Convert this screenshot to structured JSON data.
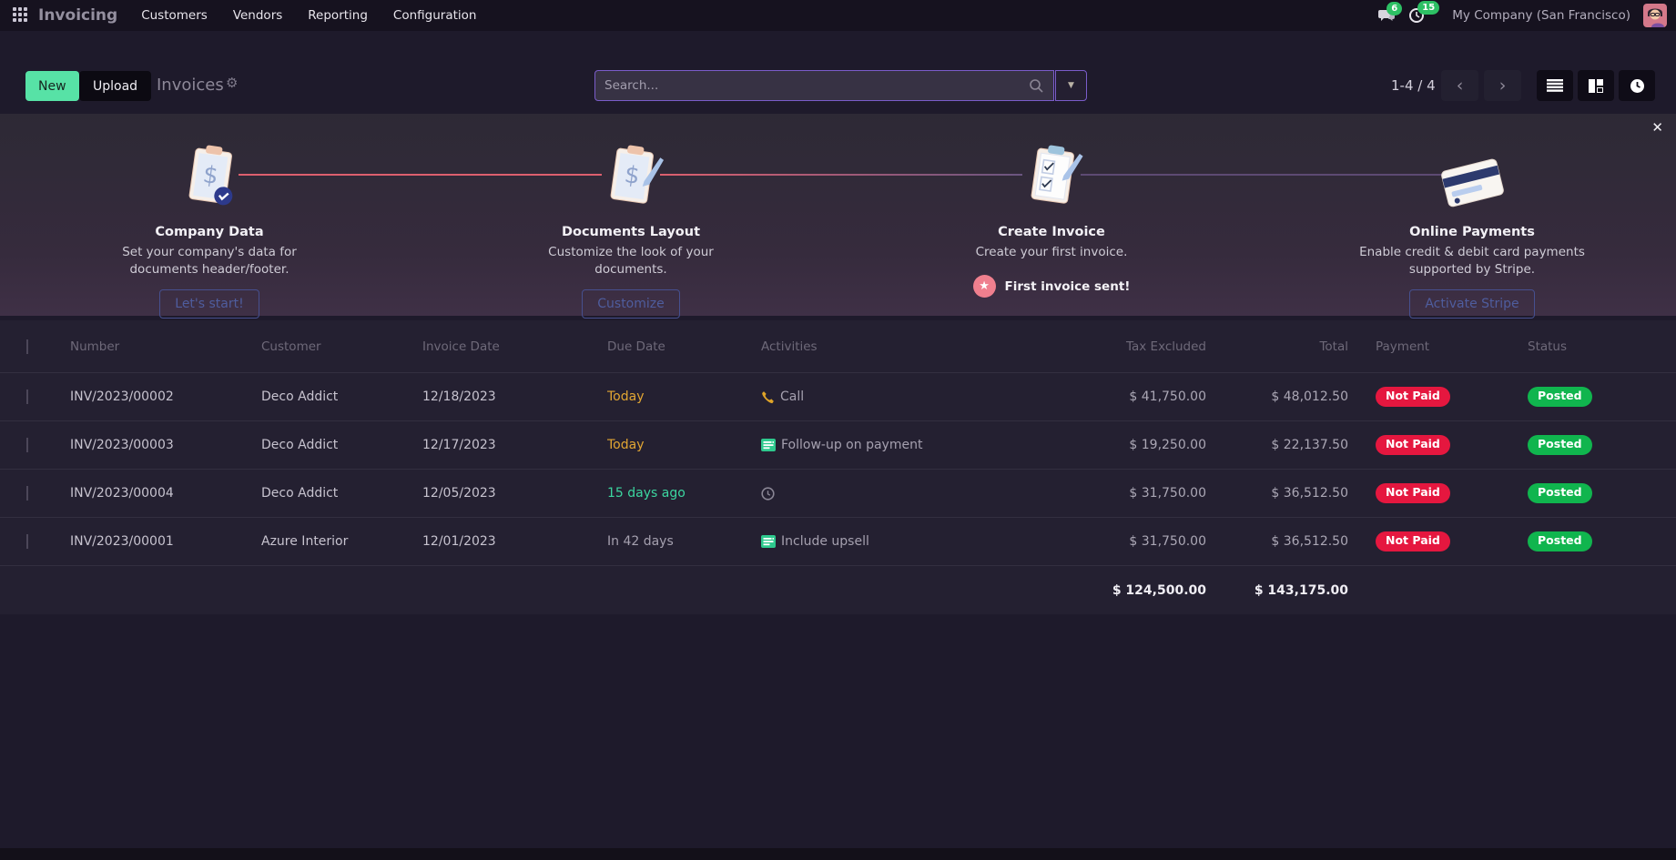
{
  "nav": {
    "app_name": "Invoicing",
    "menus": {
      "customers": "Customers",
      "vendors": "Vendors",
      "reporting": "Reporting",
      "configuration": "Configuration"
    },
    "messages_badge": "6",
    "activities_badge": "15",
    "company": "My Company (San Francisco)"
  },
  "control": {
    "new_label": "New",
    "upload_label": "Upload",
    "title": "Invoices",
    "search_placeholder": "Search...",
    "pager": "1-4 / 4",
    "icons": [
      "gear-icon",
      "search-icon",
      "caret-down-icon",
      "chevron-left-icon",
      "chevron-right-icon",
      "list-view-icon",
      "kanban-view-icon",
      "activity-view-icon"
    ]
  },
  "onboarding": {
    "close_icon": "✕",
    "steps": [
      {
        "title": "Company Data",
        "description": "Set your company's data for documents header/footer.",
        "button": "Let's start!",
        "icon": "clipboard-dollar-check-icon"
      },
      {
        "title": "Documents Layout",
        "description": "Customize the look of your documents.",
        "button": "Customize",
        "icon": "clipboard-dollar-pencil-icon"
      },
      {
        "title": "Create Invoice",
        "description": "Create your first invoice.",
        "done_label": "First invoice sent!",
        "icon": "clipboard-checklist-icon"
      },
      {
        "title": "Online Payments",
        "description": "Enable credit & debit card payments supported by Stripe.",
        "button": "Activate Stripe",
        "icon": "credit-card-icon"
      }
    ]
  },
  "table": {
    "columns": [
      "Number",
      "Customer",
      "Invoice Date",
      "Due Date",
      "Activities",
      "Tax Excluded",
      "Total",
      "Payment",
      "Status"
    ],
    "rows": [
      {
        "number": "INV/2023/00002",
        "customer": "Deco Addict",
        "invoice_date": "12/18/2023",
        "due_date": "Today",
        "activity_icon": "phone-icon",
        "activity_label": "Call",
        "tax_excluded": "$ 41,750.00",
        "total": "$ 48,012.50",
        "payment": "Not Paid",
        "status": "Posted"
      },
      {
        "number": "INV/2023/00003",
        "customer": "Deco Addict",
        "invoice_date": "12/17/2023",
        "due_date": "Today",
        "activity_icon": "list-activity-icon",
        "activity_label": "Follow-up on payment",
        "tax_excluded": "$ 19,250.00",
        "total": "$ 22,137.50",
        "payment": "Not Paid",
        "status": "Posted"
      },
      {
        "number": "INV/2023/00004",
        "customer": "Deco Addict",
        "invoice_date": "12/05/2023",
        "due_date": "15 days ago",
        "activity_icon": "clock-icon",
        "activity_label": "",
        "tax_excluded": "$ 31,750.00",
        "total": "$ 36,512.50",
        "payment": "Not Paid",
        "status": "Posted"
      },
      {
        "number": "INV/2023/00001",
        "customer": "Azure Interior",
        "invoice_date": "12/01/2023",
        "due_date": "In 42 days",
        "activity_icon": "list-activity-icon",
        "activity_label": "Include upsell",
        "tax_excluded": "$ 31,750.00",
        "total": "$ 36,512.50",
        "payment": "Not Paid",
        "status": "Posted"
      }
    ],
    "totals": {
      "tax_excluded": "$ 124,500.00",
      "total": "$ 143,175.00"
    }
  },
  "colors": {
    "accent_green": "#57e2a6",
    "badge_green": "#2dc064",
    "pill_red": "#e5173f",
    "pill_green": "#10b54e",
    "due_warning": "#e2a633",
    "due_success": "#3cd6a0",
    "search_border": "#7a5cc9",
    "onboarding_button": "#46508f",
    "connector_pink": "#dd5f6e",
    "connector_purple": "#5d4a73"
  }
}
